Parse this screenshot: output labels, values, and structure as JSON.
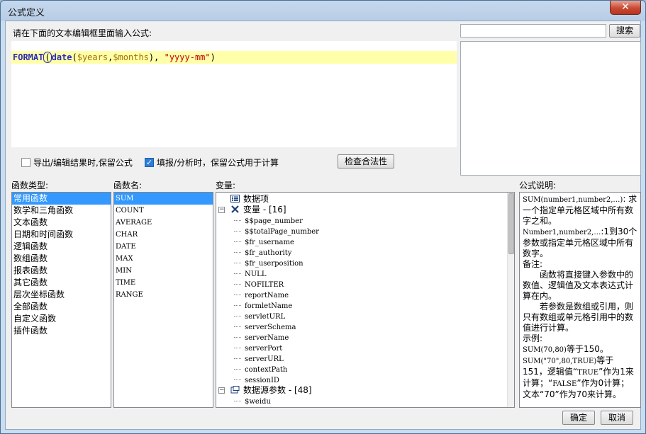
{
  "window": {
    "title": "公式定义"
  },
  "editor": {
    "prompt": "请在下面的文本编辑框里面输入公式:",
    "formula": {
      "fn_outer": "FORMAT",
      "paren_open": "(",
      "fn_inner": "date",
      "paren_inner_open": "(",
      "arg1": "$years",
      "comma1": ",",
      "arg2": "$months",
      "paren_inner_close": "),",
      "space": " ",
      "arg3": "\"yyyy-mm\"",
      "paren_close": ")"
    }
  },
  "search": {
    "value": "",
    "button_label": "搜索"
  },
  "options": {
    "export_keep_formula": {
      "label": "导出/编辑结果时,保留公式",
      "checked": false
    },
    "fill_keep_formula": {
      "label": "填报/分析时，保留公式用于计算",
      "checked": true
    },
    "check_button_label": "检查合法性"
  },
  "function_types": {
    "label": "函数类型:",
    "items": [
      "常用函数",
      "数学和三角函数",
      "文本函数",
      "日期和时间函数",
      "逻辑函数",
      "数组函数",
      "报表函数",
      "其它函数",
      "层次坐标函数",
      "全部函数",
      "自定义函数",
      "插件函数"
    ],
    "selected_index": 0
  },
  "function_names": {
    "label": "函数名:",
    "items": [
      "SUM",
      "COUNT",
      "AVERAGE",
      "CHAR",
      "DATE",
      "MAX",
      "MIN",
      "TIME",
      "RANGE"
    ],
    "selected_index": 0
  },
  "variables": {
    "label": "变量:",
    "data_item": "数据项",
    "vars_group": "变量 - [16]",
    "vars": [
      "$$page_number",
      "$$totalPage_number",
      "$fr_username",
      "$fr_authority",
      "$fr_userposition",
      "NULL",
      "NOFILTER",
      "reportName",
      "formletName",
      "servletURL",
      "serverSchema",
      "serverName",
      "serverPort",
      "serverURL",
      "contextPath",
      "sessionID"
    ],
    "ds_group": "数据源参数 - [48]",
    "ds_params": [
      "$weidu"
    ]
  },
  "description": {
    "label": "公式说明:",
    "line1": "SUM(number1,number2,…)",
    "line1b": ": 求一个指定单元格区域中所有数字之和。",
    "line2": "Number1,number2,…",
    "line2b": ":1到30个参数或指定单元格区域中所有数字。",
    "note_label": "备注:",
    "note1": "函数将直接键入参数中的数值、逻辑值及文本表达式计算在内。",
    "note2": "若参数是数组或引用，则只有数组或单元格引用中的数值进行计算。",
    "example_label": "示例:",
    "ex1a": "SUM(70,80)",
    "ex1b": "等于150。",
    "ex2a": "SUM(\"70\",80,TRUE)",
    "ex2b": "等于151，逻辑值“",
    "ex2c": "TRUE",
    "ex2d": "”作为1来计算；“",
    "ex2e": "FALSE",
    "ex2f": "”作为0计算；文本“70”作为70来计算。"
  },
  "buttons": {
    "ok": "确定",
    "cancel": "取消"
  }
}
